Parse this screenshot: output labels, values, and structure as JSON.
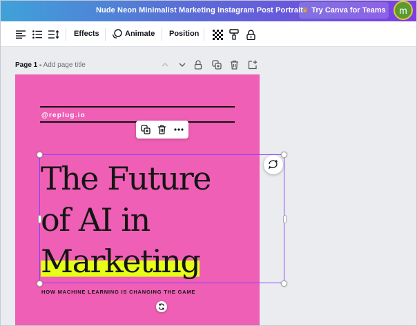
{
  "header": {
    "doc_title": "Nude Neon Minimalist Marketing Instagram Post Portrait",
    "try_button": "Try Canva for Teams",
    "avatar_letter": "m"
  },
  "toolbar": {
    "effects": "Effects",
    "animate": "Animate",
    "position": "Position"
  },
  "page": {
    "label": "Page 1 -",
    "title_placeholder": "Add page title"
  },
  "design": {
    "handle": "@replug.io",
    "headline_line1": "The Future",
    "headline_line2": "of AI in",
    "headline_line3": "Marketing",
    "tagline": "HOW MACHINE LEARNING IS CHANGING THE GAME"
  },
  "colors": {
    "page_background": "#ef5fb5",
    "highlight": "#e5ff16",
    "selection": "#8b3dff"
  }
}
